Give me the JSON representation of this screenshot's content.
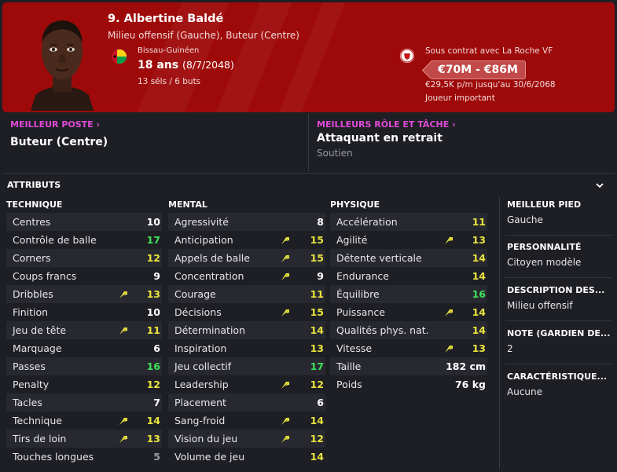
{
  "header": {
    "name": "9. Albertine Baldé",
    "positions": "Milieu offensif (Gauche), Buteur (Centre)",
    "nationality": "Bissau-Guinéen",
    "age": "18 ans",
    "dob": "(8/7/2048)",
    "caps": "13 séls / 6 buts",
    "contract": "Sous contrat avec La Roche VF",
    "value": "€70M - €86M",
    "wage": "€29,5K p/m jusqu'au 30/6/2068",
    "status": "Joueur important"
  },
  "roles": {
    "best_position_label": "MEILLEUR POSTE",
    "best_position": "Buteur (Centre)",
    "best_role_label": "MEILLEURS RÔLE ET TÂCHE",
    "best_role": "Attaquant en retrait",
    "best_role_duty": "Soutien"
  },
  "attributes": {
    "title": "ATTRIBUTS",
    "technique": {
      "title": "TECHNIQUE",
      "rows": [
        {
          "name": "Centres",
          "value": "10",
          "color": "#ffffff",
          "arrow": false
        },
        {
          "name": "Contrôle de balle",
          "value": "17",
          "color": "#3de05a",
          "arrow": false
        },
        {
          "name": "Corners",
          "value": "12",
          "color": "#e9e33e",
          "arrow": false
        },
        {
          "name": "Coups francs",
          "value": "9",
          "color": "#ffffff",
          "arrow": false
        },
        {
          "name": "Dribbles",
          "value": "13",
          "color": "#e9e33e",
          "arrow": true
        },
        {
          "name": "Finition",
          "value": "10",
          "color": "#ffffff",
          "arrow": false
        },
        {
          "name": "Jeu de tête",
          "value": "11",
          "color": "#e9e33e",
          "arrow": true
        },
        {
          "name": "Marquage",
          "value": "6",
          "color": "#ffffff",
          "arrow": false
        },
        {
          "name": "Passes",
          "value": "16",
          "color": "#3de05a",
          "arrow": false
        },
        {
          "name": "Penalty",
          "value": "12",
          "color": "#e9e33e",
          "arrow": false
        },
        {
          "name": "Tacles",
          "value": "7",
          "color": "#ffffff",
          "arrow": false
        },
        {
          "name": "Technique",
          "value": "14",
          "color": "#e9e33e",
          "arrow": true
        },
        {
          "name": "Tirs de loin",
          "value": "13",
          "color": "#e9e33e",
          "arrow": true
        },
        {
          "name": "Touches longues",
          "value": "5",
          "color": "#9a9ba2",
          "arrow": false
        }
      ]
    },
    "mental": {
      "title": "MENTAL",
      "rows": [
        {
          "name": "Agressivité",
          "value": "8",
          "color": "#ffffff",
          "arrow": false
        },
        {
          "name": "Anticipation",
          "value": "15",
          "color": "#e9e33e",
          "arrow": true
        },
        {
          "name": "Appels de balle",
          "value": "15",
          "color": "#e9e33e",
          "arrow": true
        },
        {
          "name": "Concentration",
          "value": "9",
          "color": "#ffffff",
          "arrow": true
        },
        {
          "name": "Courage",
          "value": "11",
          "color": "#e9e33e",
          "arrow": false
        },
        {
          "name": "Décisions",
          "value": "15",
          "color": "#e9e33e",
          "arrow": true
        },
        {
          "name": "Détermination",
          "value": "14",
          "color": "#e9e33e",
          "arrow": false
        },
        {
          "name": "Inspiration",
          "value": "13",
          "color": "#e9e33e",
          "arrow": false
        },
        {
          "name": "Jeu collectif",
          "value": "17",
          "color": "#3de05a",
          "arrow": false
        },
        {
          "name": "Leadership",
          "value": "12",
          "color": "#e9e33e",
          "arrow": true
        },
        {
          "name": "Placement",
          "value": "6",
          "color": "#ffffff",
          "arrow": false
        },
        {
          "name": "Sang-froid",
          "value": "14",
          "color": "#e9e33e",
          "arrow": true
        },
        {
          "name": "Vision du jeu",
          "value": "12",
          "color": "#e9e33e",
          "arrow": true
        },
        {
          "name": "Volume de jeu",
          "value": "14",
          "color": "#e9e33e",
          "arrow": false
        }
      ]
    },
    "physique": {
      "title": "PHYSIQUE",
      "rows": [
        {
          "name": "Accélération",
          "value": "11",
          "color": "#e9e33e",
          "arrow": false
        },
        {
          "name": "Agilité",
          "value": "13",
          "color": "#e9e33e",
          "arrow": true
        },
        {
          "name": "Détente verticale",
          "value": "14",
          "color": "#e9e33e",
          "arrow": false
        },
        {
          "name": "Endurance",
          "value": "14",
          "color": "#e9e33e",
          "arrow": false
        },
        {
          "name": "Équilibre",
          "value": "16",
          "color": "#3de05a",
          "arrow": false
        },
        {
          "name": "Puissance",
          "value": "14",
          "color": "#e9e33e",
          "arrow": true
        },
        {
          "name": "Qualités phys. nat.",
          "value": "14",
          "color": "#e9e33e",
          "arrow": false
        },
        {
          "name": "Vitesse",
          "value": "13",
          "color": "#e9e33e",
          "arrow": true
        },
        {
          "name": "Taille",
          "value": "182 cm",
          "color": "#ffffff",
          "arrow": false
        },
        {
          "name": "Poids",
          "value": "76 kg",
          "color": "#ffffff",
          "arrow": false
        }
      ]
    }
  },
  "side": [
    {
      "label": "MEILLEUR PIED",
      "value": "Gauche"
    },
    {
      "label": "PERSONNALITÉ",
      "value": "Citoyen modèle"
    },
    {
      "label": "DESCRIPTION DES...",
      "value": "Milieu offensif"
    },
    {
      "label": "NOTE (GARDIEN DE...",
      "value": "2"
    },
    {
      "label": "CARACTÉRISTIQUE...",
      "value": "Aucune"
    }
  ]
}
